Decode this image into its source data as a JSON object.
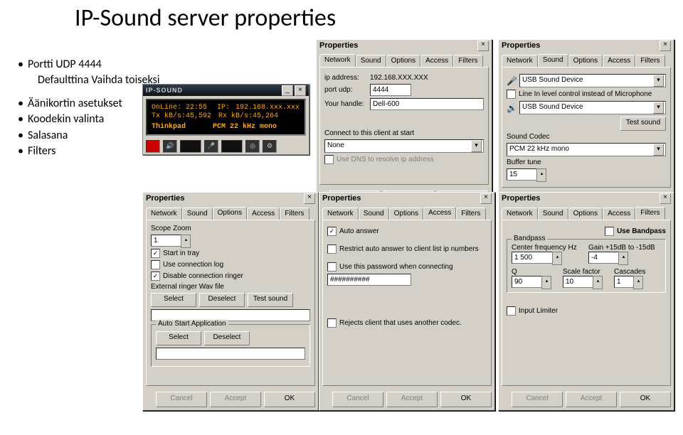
{
  "title": "IP-Sound server properties",
  "bullets": [
    "Portti UDP 4444",
    "Defaulttina Vaihda toiseksi",
    "Äänikortin asetukset",
    "Koodekin valinta",
    "Salasana",
    "Filters"
  ],
  "app": {
    "title": "IP-SOUND",
    "online_lbl": "OnLine:",
    "online_val": "22:55",
    "ip_lbl": "IP:",
    "ip_val": "192.168.xxx.xxx",
    "tx_lbl": "Tx kB/s:",
    "tx_val": "45,592",
    "rx_lbl": "Rx kB/s:",
    "rx_val": "45,264",
    "handle": "Thinkpad",
    "codec": "PCM 22 kHz mono"
  },
  "common": {
    "props": "Properties",
    "tabs": [
      "Network",
      "Sound",
      "Options",
      "Access",
      "Filters"
    ],
    "cancel": "Cancel",
    "accept": "Accept",
    "ok": "OK",
    "select": "Select",
    "deselect": "Deselect",
    "testsound": "Test sound"
  },
  "pw1": {
    "ipaddr_lbl": "ip address:",
    "ipaddr_val": "192.168.XXX.XXX",
    "port_lbl": "port udp:",
    "port_val": "4444",
    "handle_lbl": "Your handle:",
    "handle_val": "Dell-600",
    "connect_lbl": "Connect to this client at start",
    "connect_val": "None",
    "dns_lbl": "Use DNS to resolve ip address"
  },
  "pw2": {
    "dev_in": "USB Sound Device",
    "linein_lbl": "Line In level control instead of Microphone",
    "dev_out": "USB Sound Device",
    "codec_lbl": "Sound Codec",
    "codec_val": "PCM 22 kHz mono",
    "buffer_lbl": "Buffer tune",
    "buffer_val": "15"
  },
  "pw3": {
    "scope_lbl": "Scope Zoom",
    "scope_val": "1",
    "tray": "Start in tray",
    "connlog": "Use connection log",
    "ringer": "Disable connection ringer",
    "ext_lbl": "External ringer Wav file",
    "auto_lbl": "Auto Start Application"
  },
  "pw4": {
    "autoans": "Auto answer",
    "restrict": "Restrict auto answer to client list ip numbers",
    "usepass": "Use this password when connecting",
    "passval": "##########",
    "rejects": "Rejects client that uses another codec."
  },
  "pw5": {
    "usebp": "Use Bandpass",
    "bp_lbl": "Bandpass",
    "cf_lbl": "Center frequency Hz",
    "gain_lbl": "Gain +15dB to -15dB",
    "q_lbl": "Q",
    "scale_lbl": "Scale factor",
    "casc_lbl": "Cascades",
    "cf": "1 500",
    "gain": "-4",
    "q": "90",
    "scale": "10",
    "casc": "1",
    "limiter": "Input Limiter"
  }
}
